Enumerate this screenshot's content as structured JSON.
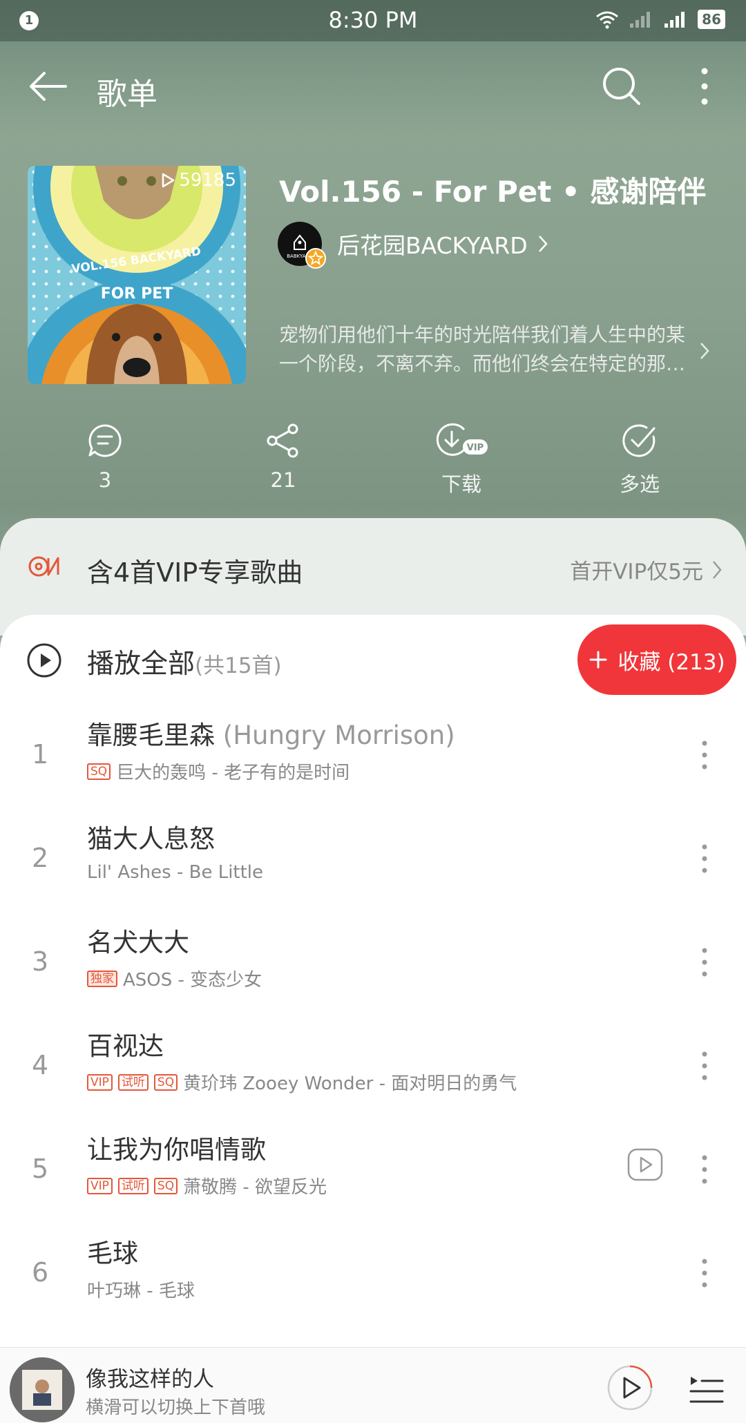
{
  "status_bar": {
    "notification_count": "1",
    "time": "8:30 PM",
    "battery": "86",
    "icons": [
      "wifi-icon",
      "signal-icon",
      "signal-icon"
    ]
  },
  "header": {
    "title": "歌单",
    "back_icon": "back-arrow-icon",
    "search_icon": "search-icon",
    "more_icon": "more-vertical-icon"
  },
  "playlist": {
    "play_count": "59185",
    "title": "Vol.156 - For Pet • 感谢陪伴",
    "creator": "后花园BACKYARD",
    "creator_avatar_text": "BABKYARD",
    "description": "宠物们用他们十年的时光陪伴我们着人生中的某一个阶段，不离不弃。而他们终会在特定的那…",
    "cover_text_1": "VOL.156 BACKYARD",
    "cover_text_2": "FOR PET"
  },
  "actions": [
    {
      "icon": "comment-icon",
      "label": "3"
    },
    {
      "icon": "share-icon",
      "label": "21"
    },
    {
      "icon": "download-vip-icon",
      "label": "下载"
    },
    {
      "icon": "multi-select-icon",
      "label": "多选"
    }
  ],
  "vip_banner": {
    "text": "含4首VIP专享歌曲",
    "promo": "首开VIP仅5元"
  },
  "play_all": {
    "label": "播放全部",
    "count": "(共15首)",
    "collect_label": "收藏 (213)"
  },
  "songs": [
    {
      "index": "1",
      "title": "靠腰毛里森",
      "alias": " (Hungry Morrison)",
      "tags": [
        "SQ"
      ],
      "subtitle": "巨大的轰鸣 - 老子有的是时间",
      "has_mv": false
    },
    {
      "index": "2",
      "title": "猫大人息怒",
      "alias": "",
      "tags": [],
      "subtitle": "Lil' Ashes - Be Little",
      "has_mv": false
    },
    {
      "index": "3",
      "title": "名犬大大",
      "alias": "",
      "tags": [
        "独家"
      ],
      "subtitle": "ASOS - 变态少女",
      "has_mv": false
    },
    {
      "index": "4",
      "title": "百视达",
      "alias": "",
      "tags": [
        "VIP",
        "试听",
        "SQ"
      ],
      "subtitle": "黄玠玮 Zooey Wonder - 面对明日的勇气",
      "has_mv": false
    },
    {
      "index": "5",
      "title": "让我为你唱情歌",
      "alias": "",
      "tags": [
        "VIP",
        "试听",
        "SQ"
      ],
      "subtitle": "萧敬腾 - 欲望反光",
      "has_mv": true
    },
    {
      "index": "6",
      "title": "毛球",
      "alias": "",
      "tags": [],
      "subtitle": "叶巧琳 - 毛球",
      "has_mv": false
    }
  ],
  "mini_player": {
    "title": "像我这样的人",
    "subtitle": "横滑可以切换上下首哦"
  },
  "colors": {
    "accent_red": "#f0363a",
    "tag_red": "#e4573a",
    "header_bg": "#8aa08f"
  }
}
